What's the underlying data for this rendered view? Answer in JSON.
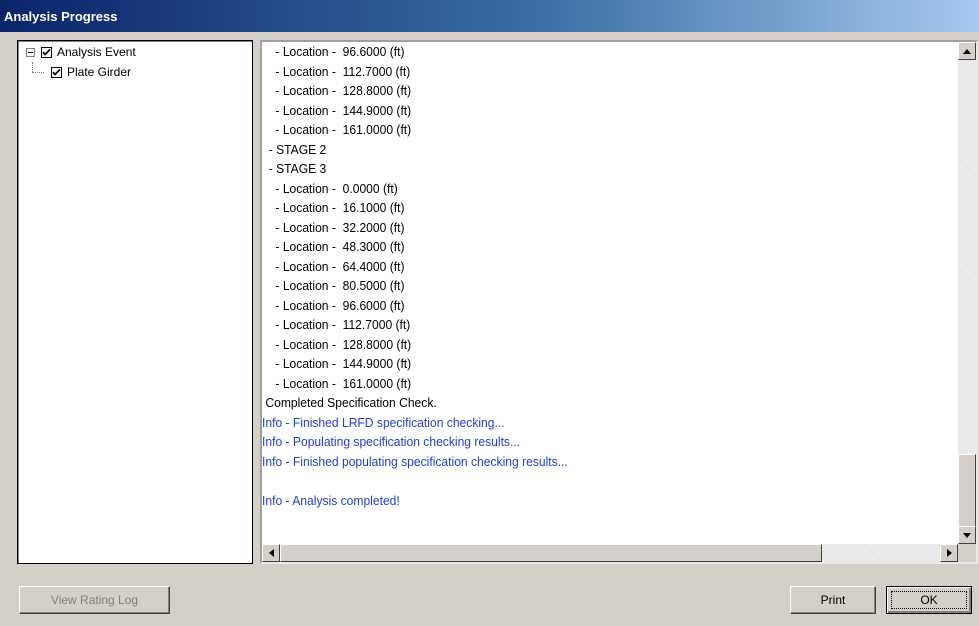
{
  "window": {
    "title": "Analysis Progress"
  },
  "tree": {
    "items": [
      {
        "label": "Analysis Event",
        "checked": true,
        "expanded": true
      },
      {
        "label": "Plate Girder",
        "checked": true
      }
    ]
  },
  "log": {
    "lines": [
      {
        "text": "    - Location -  96.6000 (ft)",
        "type": "normal"
      },
      {
        "text": "    - Location -  112.7000 (ft)",
        "type": "normal"
      },
      {
        "text": "    - Location -  128.8000 (ft)",
        "type": "normal"
      },
      {
        "text": "    - Location -  144.9000 (ft)",
        "type": "normal"
      },
      {
        "text": "    - Location -  161.0000 (ft)",
        "type": "normal"
      },
      {
        "text": "  - STAGE 2",
        "type": "normal"
      },
      {
        "text": "  - STAGE 3",
        "type": "normal"
      },
      {
        "text": "    - Location -  0.0000 (ft)",
        "type": "normal"
      },
      {
        "text": "    - Location -  16.1000 (ft)",
        "type": "normal"
      },
      {
        "text": "    - Location -  32.2000 (ft)",
        "type": "normal"
      },
      {
        "text": "    - Location -  48.3000 (ft)",
        "type": "normal"
      },
      {
        "text": "    - Location -  64.4000 (ft)",
        "type": "normal"
      },
      {
        "text": "    - Location -  80.5000 (ft)",
        "type": "normal"
      },
      {
        "text": "    - Location -  96.6000 (ft)",
        "type": "normal"
      },
      {
        "text": "    - Location -  112.7000 (ft)",
        "type": "normal"
      },
      {
        "text": "    - Location -  128.8000 (ft)",
        "type": "normal"
      },
      {
        "text": "    - Location -  144.9000 (ft)",
        "type": "normal"
      },
      {
        "text": "    - Location -  161.0000 (ft)",
        "type": "normal"
      },
      {
        "text": " Completed Specification Check.",
        "type": "normal"
      },
      {
        "text": "Info - Finished LRFD specification checking...",
        "type": "info"
      },
      {
        "text": "Info - Populating specification checking results...",
        "type": "info"
      },
      {
        "text": "Info - Finished populating specification checking results...",
        "type": "info"
      },
      {
        "text": "",
        "type": "normal"
      },
      {
        "text": "Info - Analysis completed!",
        "type": "info"
      }
    ]
  },
  "buttons": {
    "view_rating_log": "View Rating Log",
    "print": "Print",
    "ok": "OK"
  },
  "colors": {
    "info_text": "#1f3fcf",
    "title_gradient_start": "#0a246a",
    "title_gradient_end": "#a6caf0"
  }
}
